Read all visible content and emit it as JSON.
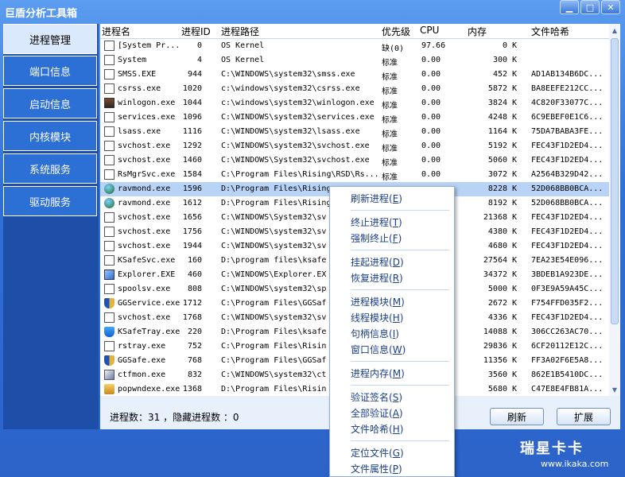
{
  "window": {
    "title": "巨盾分析工具箱"
  },
  "window_buttons": [
    {
      "name": "minimize-button",
      "glyph": "▁"
    },
    {
      "name": "maximize-button",
      "glyph": "□"
    },
    {
      "name": "close-button",
      "glyph": "✕"
    }
  ],
  "sidebar": {
    "items": [
      {
        "label": "进程管理",
        "active": true
      },
      {
        "label": "端口信息",
        "active": false
      },
      {
        "label": "启动信息",
        "active": false
      },
      {
        "label": "内核模块",
        "active": false
      },
      {
        "label": "系统服务",
        "active": false
      },
      {
        "label": "驱动服务",
        "active": false
      }
    ]
  },
  "table": {
    "columns": [
      "进程名",
      "进程ID",
      "进程路径",
      "优先级",
      "CPU",
      "内存",
      "文件哈希"
    ],
    "rows": [
      {
        "icon": "blank",
        "name": "[System Pr...",
        "pid": "0",
        "path": "OS Kernel",
        "priority": "缺(0)",
        "cpu": "97.66",
        "mem": "0",
        "unit": "K",
        "hash": ""
      },
      {
        "icon": "blank",
        "name": "System",
        "pid": "4",
        "path": "OS Kernel",
        "priority": "标准",
        "cpu": "0.00",
        "mem": "300",
        "unit": "K",
        "hash": ""
      },
      {
        "icon": "blank",
        "name": "SMSS.EXE",
        "pid": "944",
        "path": "C:\\WINDOWS\\system32\\smss.exe",
        "priority": "标准",
        "cpu": "0.00",
        "mem": "452",
        "unit": "K",
        "hash": "AD1AB134B6DC..."
      },
      {
        "icon": "blank",
        "name": "csrss.exe",
        "pid": "1020",
        "path": "c:\\windows\\system32\\csrss.exe",
        "priority": "标准",
        "cpu": "0.00",
        "mem": "5872",
        "unit": "K",
        "hash": "BA8EEFE212CC..."
      },
      {
        "icon": "winlogon",
        "name": "winlogon.exe",
        "pid": "1044",
        "path": "c:\\windows\\system32\\winlogon.exe",
        "priority": "标准",
        "cpu": "0.00",
        "mem": "3824",
        "unit": "K",
        "hash": "4C820F33077C..."
      },
      {
        "icon": "blank",
        "name": "services.exe",
        "pid": "1096",
        "path": "C:\\WINDOWS\\system32\\services.exe",
        "priority": "标准",
        "cpu": "0.00",
        "mem": "4248",
        "unit": "K",
        "hash": "6C9EBEF0E1C6..."
      },
      {
        "icon": "blank",
        "name": "lsass.exe",
        "pid": "1116",
        "path": "C:\\WINDOWS\\system32\\lsass.exe",
        "priority": "标准",
        "cpu": "0.00",
        "mem": "1164",
        "unit": "K",
        "hash": "75DA7BABA3FE..."
      },
      {
        "icon": "blank",
        "name": "svchost.exe",
        "pid": "1292",
        "path": "C:\\WINDOWS\\system32\\svchost.exe",
        "priority": "标准",
        "cpu": "0.00",
        "mem": "5192",
        "unit": "K",
        "hash": "FEC43F1D2ED4..."
      },
      {
        "icon": "blank",
        "name": "svchost.exe",
        "pid": "1460",
        "path": "C:\\WINDOWS\\System32\\svchost.exe",
        "priority": "标准",
        "cpu": "0.00",
        "mem": "5060",
        "unit": "K",
        "hash": "FEC43F1D2ED4..."
      },
      {
        "icon": "blank",
        "name": "RsMgrSvc.exe",
        "pid": "1584",
        "path": "C:\\Program Files\\Rising\\RSD\\Rs...",
        "priority": "标准",
        "cpu": "0.00",
        "mem": "3072",
        "unit": "K",
        "hash": "A2564B329D42..."
      },
      {
        "icon": "globe",
        "name": "ravmond.exe",
        "pid": "1596",
        "path": "D:\\Program Files\\Rising",
        "priority": "",
        "cpu": "",
        "mem": "8228",
        "unit": "K",
        "hash": "52D068BB0BCA..."
      },
      {
        "icon": "globe",
        "name": "ravmond.exe",
        "pid": "1612",
        "path": "D:\\Program Files\\Rising",
        "priority": "",
        "cpu": "",
        "mem": "8192",
        "unit": "K",
        "hash": "52D068BB0BCA..."
      },
      {
        "icon": "blank",
        "name": "svchost.exe",
        "pid": "1656",
        "path": "C:\\WINDOWS\\System32\\sv",
        "priority": "",
        "cpu": "",
        "mem": "21368",
        "unit": "K",
        "hash": "FEC43F1D2ED4..."
      },
      {
        "icon": "blank",
        "name": "svchost.exe",
        "pid": "1756",
        "path": "C:\\WINDOWS\\system32\\sv",
        "priority": "",
        "cpu": "",
        "mem": "4380",
        "unit": "K",
        "hash": "FEC43F1D2ED4..."
      },
      {
        "icon": "blank",
        "name": "svchost.exe",
        "pid": "1944",
        "path": "C:\\WINDOWS\\system32\\sv",
        "priority": "",
        "cpu": "",
        "mem": "4680",
        "unit": "K",
        "hash": "FEC43F1D2ED4..."
      },
      {
        "icon": "blank",
        "name": "KSafeSvc.exe",
        "pid": "160",
        "path": "D:\\program files\\ksafe",
        "priority": "",
        "cpu": "",
        "mem": "27564",
        "unit": "K",
        "hash": "7EA23E54E096..."
      },
      {
        "icon": "explorer",
        "name": "Explorer.EXE",
        "pid": "460",
        "path": "C:\\WINDOWS\\Explorer.EX",
        "priority": "",
        "cpu": "",
        "mem": "34372",
        "unit": "K",
        "hash": "3BDEB1A923DE..."
      },
      {
        "icon": "blank",
        "name": "spoolsv.exe",
        "pid": "808",
        "path": "C:\\WINDOWS\\system32\\sp",
        "priority": "",
        "cpu": "",
        "mem": "5000",
        "unit": "K",
        "hash": "0F3E9A59A45C..."
      },
      {
        "icon": "shield",
        "name": "GGService.exe",
        "pid": "1712",
        "path": "C:\\Program Files\\GGSaf",
        "priority": "",
        "cpu": "",
        "mem": "2672",
        "unit": "K",
        "hash": "F754FFD035F2..."
      },
      {
        "icon": "blank",
        "name": "svchost.exe",
        "pid": "1768",
        "path": "C:\\WINDOWS\\system32\\sv",
        "priority": "",
        "cpu": "",
        "mem": "4336",
        "unit": "K",
        "hash": "FEC43F1D2ED4..."
      },
      {
        "icon": "ksafe",
        "name": "KSafeTray.exe",
        "pid": "220",
        "path": "D:\\Program Files\\ksafe",
        "priority": "",
        "cpu": "",
        "mem": "14088",
        "unit": "K",
        "hash": "306CC263AC70..."
      },
      {
        "icon": "blank",
        "name": "rstray.exe",
        "pid": "752",
        "path": "C:\\Program Files\\Risin",
        "priority": "",
        "cpu": "",
        "mem": "29836",
        "unit": "K",
        "hash": "6CF20112E12C..."
      },
      {
        "icon": "shield",
        "name": "GGSafe.exe",
        "pid": "768",
        "path": "C:\\Program Files\\GGSaf",
        "priority": "",
        "cpu": "",
        "mem": "11356",
        "unit": "K",
        "hash": "FF3A02F6E5A8..."
      },
      {
        "icon": "ctfmon",
        "name": "ctfmon.exe",
        "pid": "832",
        "path": "C:\\WINDOWS\\system32\\ct",
        "priority": "",
        "cpu": "",
        "mem": "3560",
        "unit": "K",
        "hash": "862E1B5410DC..."
      },
      {
        "icon": "box",
        "name": "popwndexe.exe",
        "pid": "1368",
        "path": "D:\\Program Files\\Risin",
        "priority": "",
        "cpu": "",
        "mem": "5680",
        "unit": "K",
        "hash": "C47E8E4FB81A..."
      }
    ],
    "selected_row": 10
  },
  "status": {
    "text": "进程数：31 ，隐藏进程数 ：0"
  },
  "buttons": {
    "refresh": "刷新",
    "expand": "扩展"
  },
  "context_menu": {
    "items": [
      {
        "label": "刷新进程",
        "key": "E",
        "name": "menu-refresh-process"
      },
      {
        "sep": true
      },
      {
        "label": "终止进程",
        "key": "T",
        "name": "menu-terminate-process"
      },
      {
        "label": "强制终止",
        "key": "F",
        "name": "menu-force-terminate"
      },
      {
        "sep": true
      },
      {
        "label": "挂起进程",
        "key": "D",
        "name": "menu-suspend-process"
      },
      {
        "label": "恢复进程",
        "key": "R",
        "name": "menu-resume-process"
      },
      {
        "sep": true
      },
      {
        "label": "进程模块",
        "key": "M",
        "name": "menu-process-modules"
      },
      {
        "label": "线程模块",
        "key": "H",
        "name": "menu-thread-modules"
      },
      {
        "label": "句柄信息",
        "key": "I",
        "name": "menu-handle-info"
      },
      {
        "label": "窗口信息",
        "key": "W",
        "name": "menu-window-info"
      },
      {
        "sep": true
      },
      {
        "label": "进程内存",
        "key": "M",
        "name": "menu-process-memory"
      },
      {
        "sep": true
      },
      {
        "label": "验证签名",
        "key": "S",
        "name": "menu-verify-signature"
      },
      {
        "label": "全部验证",
        "key": "A",
        "name": "menu-verify-all"
      },
      {
        "label": "文件哈希",
        "key": "H",
        "name": "menu-file-hash"
      },
      {
        "sep": true
      },
      {
        "label": "定位文件",
        "key": "G",
        "name": "menu-locate-file"
      },
      {
        "label": "文件属性",
        "key": "P",
        "name": "menu-file-properties"
      }
    ]
  },
  "watermark": {
    "line1": "瑞星卡卡",
    "line2": "www.ikaka.com"
  },
  "colors": {
    "accent": "#2c6fd5",
    "selection": "#b9d3f7",
    "menu_text": "#1a3f8a"
  }
}
